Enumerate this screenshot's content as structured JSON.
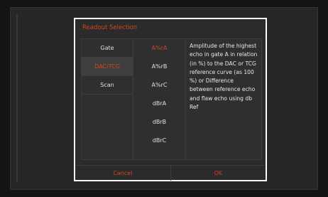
{
  "dialog": {
    "title": "Readout Selection",
    "categories": [
      {
        "label": "Gate",
        "selected": false
      },
      {
        "label": "DAC/TCG",
        "selected": true
      },
      {
        "label": "Scan",
        "selected": false
      }
    ],
    "options": [
      {
        "label": "A%rA",
        "selected": true
      },
      {
        "label": "A%rB",
        "selected": false
      },
      {
        "label": "A%rC",
        "selected": false
      },
      {
        "label": "dBrA",
        "selected": false
      },
      {
        "label": "dBrB",
        "selected": false
      },
      {
        "label": "dBrC",
        "selected": false
      }
    ],
    "description": "Amplitude of the highest echo in gate A in relation (in %) to the DAC or TCG reference curve (as 100 %) or Difference between reference echo and flaw echo using db Ref",
    "cancel_label": "Cancel",
    "ok_label": "OK"
  },
  "colors": {
    "accent": "#d2461e",
    "dialog_border": "#ffffff",
    "background": "#141414"
  }
}
